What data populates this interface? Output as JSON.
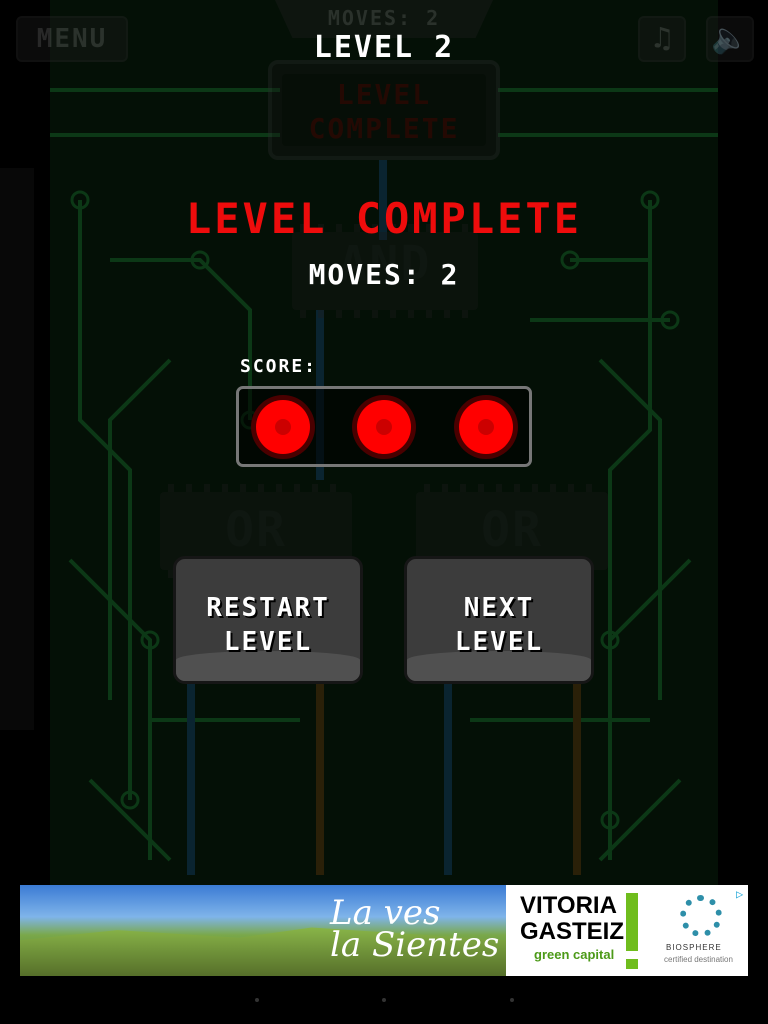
{
  "header": {
    "menu_label": "MENU",
    "moves_tab": "MOVES: 2",
    "music_icon": "music-note-icon",
    "sound_icon": "speaker-icon"
  },
  "board": {
    "screen_text": "LEVEL\nCOMPLETE",
    "top_gate_label": "AND",
    "left_gate_label": "OR",
    "right_gate_label": "OR"
  },
  "overlay": {
    "level_title": "LEVEL 2",
    "complete_title": "LEVEL COMPLETE",
    "moves_text": "MOVES: 2",
    "score_label": "SCORE:",
    "stars_earned": 3,
    "stars_total": 3,
    "restart_label": "RESTART\nLEVEL",
    "next_label": "NEXT\nLEVEL"
  },
  "ad": {
    "tagline": "La ves\nla Sientes",
    "brand": "VITORIA\nGASTEIZ",
    "brand_sub": "green capital",
    "cert_title": "BIOSPHERE",
    "cert_sub": "certified destination"
  },
  "colors": {
    "accent_red": "#ee0c0c",
    "star_red": "#ff0000",
    "board_green": "#0a3312"
  }
}
